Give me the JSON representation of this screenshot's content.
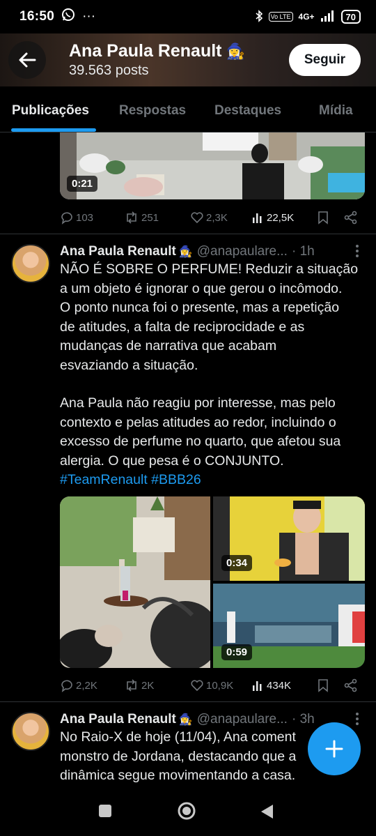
{
  "status_bar": {
    "time": "16:50",
    "more": "···",
    "volte": "Vo LTE",
    "network": "4G+",
    "battery": "70"
  },
  "header": {
    "name": "Ana Paula Renault",
    "emoji": "🧙‍♀️",
    "posts": "39.563 posts",
    "follow_label": "Seguir"
  },
  "tabs": [
    {
      "label": "Publicações",
      "active": true
    },
    {
      "label": "Respostas"
    },
    {
      "label": "Destaques"
    },
    {
      "label": "Mídia"
    }
  ],
  "post0": {
    "video_duration": "0:21",
    "replies": "103",
    "reposts": "251",
    "likes": "2,3K",
    "views": "22,5K"
  },
  "post1": {
    "name": "Ana Paula Renault",
    "emoji": "🧙‍♀️",
    "handle": "@anapaulare...",
    "time": "· 1h",
    "lines1": [
      "NÃO É SOBRE O PERFUME! Reduzir a situação",
      "a um objeto é ignorar o que gerou o incômodo.",
      "O ponto nunca foi o presente, mas a repetição",
      "de atitudes, a falta de reciprocidade e as",
      "mudanças de narrativa que acabam",
      "esvaziando a situação."
    ],
    "lines2": [
      "Ana Paula não reagiu por interesse, mas pelo",
      "contexto e pelas atitudes ao redor, incluindo o",
      "excesso de perfume no quarto, que afetou sua",
      "alergia. O que pesa é o CONJUNTO."
    ],
    "hashtags": "#TeamRenault #BBB26",
    "media_durations": [
      "0:34",
      "0:59"
    ],
    "replies": "2,2K",
    "reposts": "2K",
    "likes": "10,9K",
    "views": "434K"
  },
  "post2": {
    "name": "Ana Paula Renault",
    "emoji": "🧙‍♀️",
    "handle": "@anapaulare...",
    "time": "· 3h",
    "lines": [
      "No Raio-X de hoje (11/04), Ana coment",
      "monstro de Jordana, destacando que a",
      "dinâmica segue movimentando a casa."
    ]
  },
  "colors": {
    "accent": "#1d9bf0",
    "background": "#000000",
    "muted": "#71767b",
    "text": "#e7e9ea"
  },
  "icons": [
    "back-arrow-icon",
    "reply-icon",
    "repost-icon",
    "like-icon",
    "views-icon",
    "bookmark-icon",
    "share-icon",
    "more-icon",
    "compose-plus-icon"
  ]
}
